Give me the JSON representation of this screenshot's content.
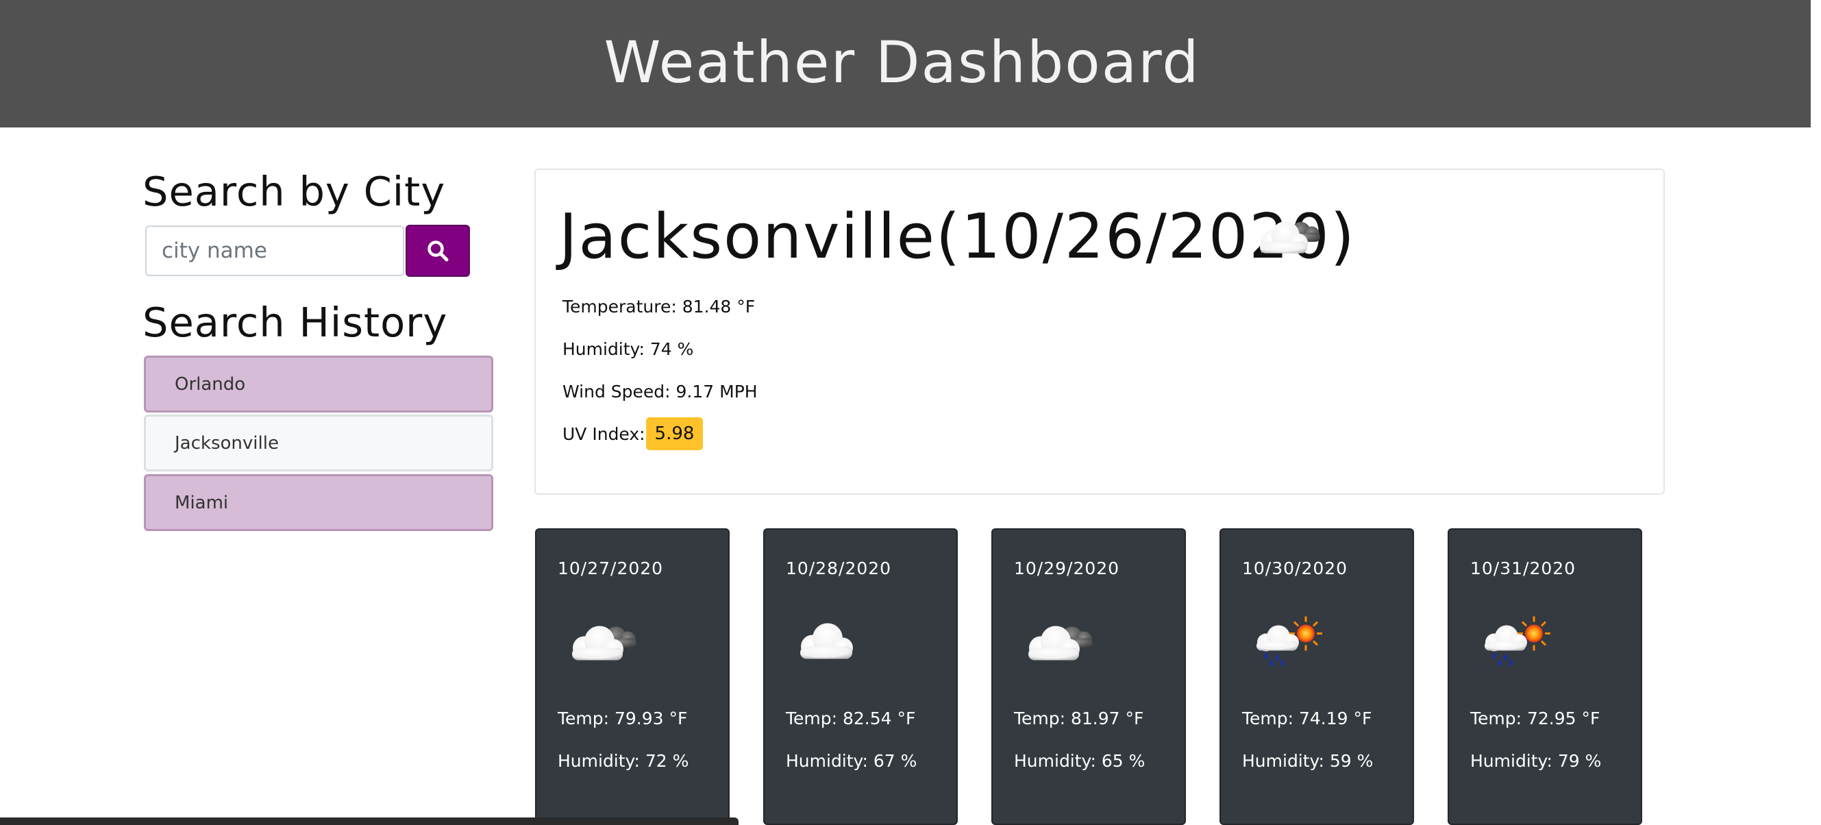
{
  "header": {
    "title": "Weather Dashboard"
  },
  "search": {
    "heading": "Search by City",
    "placeholder": "city name",
    "button_icon": "search-icon"
  },
  "history": {
    "heading": "Search History",
    "items": [
      {
        "label": "Orlando",
        "active": false
      },
      {
        "label": "Jacksonville",
        "active": true
      },
      {
        "label": "Miami",
        "active": false
      }
    ]
  },
  "current": {
    "title": "Jacksonville(10/26/2020)",
    "icon": "partly-cloudy-icon",
    "temperature": "Temperature: 81.48 °F",
    "humidity": "Humidity: 74 %",
    "wind": "Wind Speed: 9.17 MPH",
    "uv_label": "UV Index:",
    "uv_value": "5.98",
    "uv_color": "#ffc22b"
  },
  "forecast": [
    {
      "date": "10/27/2020",
      "icon": "partly-cloudy-icon",
      "temp": "Temp: 79.93 °F",
      "humidity": "Humidity: 72 %"
    },
    {
      "date": "10/28/2020",
      "icon": "cloud-icon",
      "temp": "Temp: 82.54 °F",
      "humidity": "Humidity: 67 %"
    },
    {
      "date": "10/29/2020",
      "icon": "partly-cloudy-icon",
      "temp": "Temp: 81.97 °F",
      "humidity": "Humidity: 65 %"
    },
    {
      "date": "10/30/2020",
      "icon": "rain-sun-icon",
      "temp": "Temp: 74.19 °F",
      "humidity": "Humidity: 59 %"
    },
    {
      "date": "10/31/2020",
      "icon": "rain-sun-icon",
      "temp": "Temp: 72.95 °F",
      "humidity": "Humidity: 79 %"
    }
  ],
  "colors": {
    "header_bg": "#525152",
    "accent": "#800080",
    "history_bg": "#d6bcd6",
    "forecast_bg": "#343a40"
  }
}
